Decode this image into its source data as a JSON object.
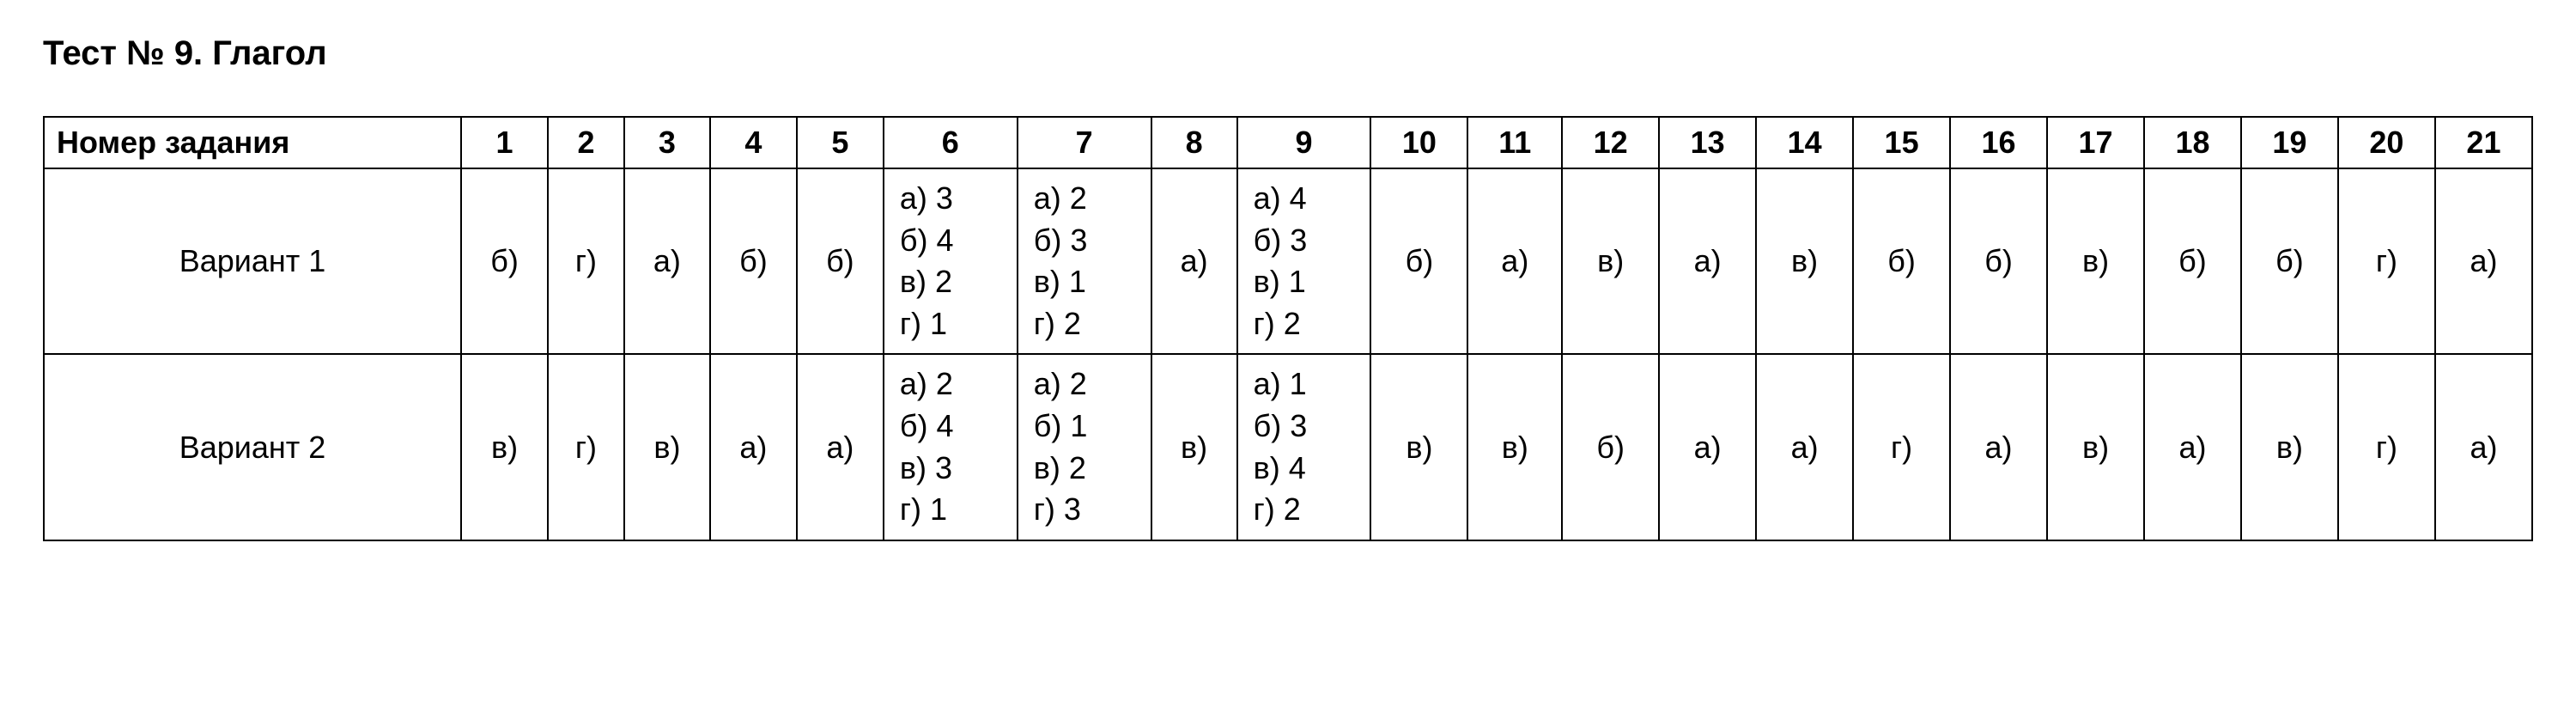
{
  "title": "Тест № 9. Глагол",
  "chart_data": {
    "type": "table",
    "header_label": "Номер задания",
    "columns": [
      "1",
      "2",
      "3",
      "4",
      "5",
      "6",
      "7",
      "8",
      "9",
      "10",
      "11",
      "12",
      "13",
      "14",
      "15",
      "16",
      "17",
      "18",
      "19",
      "20",
      "21"
    ],
    "rows": [
      {
        "label": "Вариант 1",
        "cells": [
          "б)",
          "г)",
          "а)",
          "б)",
          "б)",
          "а) 3\nб) 4\nв) 2\nг) 1",
          "а) 2\nб) 3\nв) 1\nг) 2",
          "а)",
          "а) 4\nб) 3\nв) 1\nг) 2",
          "б)",
          "а)",
          "в)",
          "а)",
          "в)",
          "б)",
          "б)",
          "в)",
          "б)",
          "б)",
          "г)",
          "а)"
        ]
      },
      {
        "label": "Вариант 2",
        "cells": [
          "в)",
          "г)",
          "в)",
          "а)",
          "а)",
          "а) 2\nб) 4\nв) 3\nг) 1",
          "а) 2\nб) 1\nв) 2\nг) 3",
          "в)",
          "а) 1\nб) 3\nв) 4\nг) 2",
          "в)",
          "в)",
          "б)",
          "а)",
          "а)",
          "г)",
          "а)",
          "в)",
          "а)",
          "в)",
          "г)",
          "а)"
        ]
      }
    ]
  }
}
